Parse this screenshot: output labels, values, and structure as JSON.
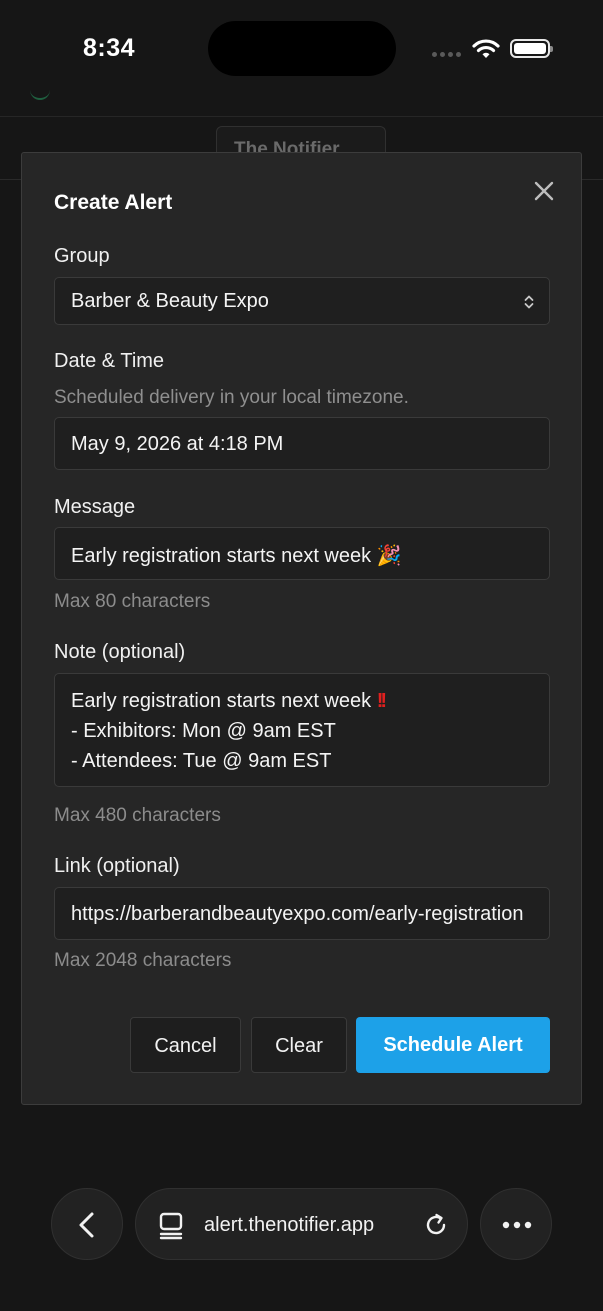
{
  "status_bar": {
    "time": "8:34"
  },
  "app": {
    "header_chip": "The Notifier"
  },
  "modal": {
    "title": "Create Alert",
    "group": {
      "label": "Group",
      "selected": "Barber & Beauty Expo"
    },
    "datetime": {
      "label": "Date & Time",
      "hint": "Scheduled delivery in your local timezone.",
      "value": "May 9, 2026 at 4:18 PM"
    },
    "message": {
      "label": "Message",
      "value": "Early registration starts next week 🎉",
      "hint": "Max 80 characters"
    },
    "note": {
      "label": "Note (optional)",
      "line1": "Early registration starts next week ",
      "line1_emoji": "!!",
      "line2": "- Exhibitors: Mon @ 9am EST",
      "line3": "- Attendees: Tue @ 9am EST",
      "hint": "Max 480 characters"
    },
    "link": {
      "label": "Link (optional)",
      "value": "https://barberandbeautyexpo.com/early-registration",
      "hint": "Max 2048 characters"
    },
    "buttons": {
      "cancel": "Cancel",
      "clear": "Clear",
      "schedule": "Schedule Alert"
    }
  },
  "browser": {
    "url": "alert.thenotifier.app"
  },
  "colors": {
    "accent": "#1da1e8",
    "background": "#161616",
    "modal": "#262626",
    "note_emoji": "#e0201f"
  },
  "icons": [
    "wifi-icon",
    "battery-icon",
    "close-icon",
    "chevron-up-down-icon",
    "back-chevron-icon",
    "tabs-icon",
    "reload-icon",
    "more-icon"
  ]
}
